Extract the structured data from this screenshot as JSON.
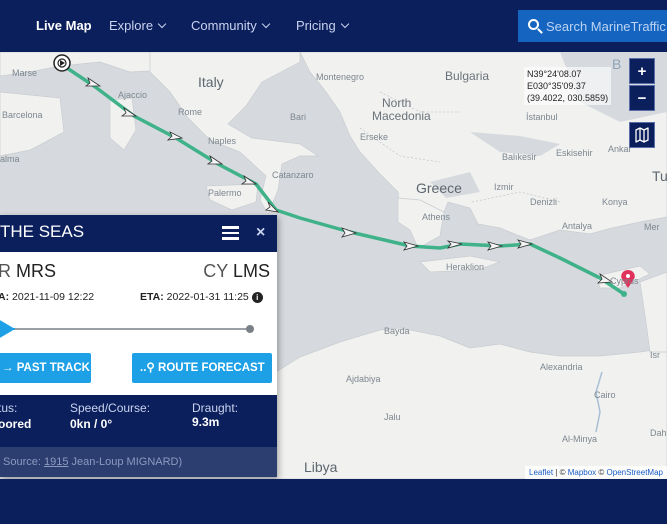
{
  "nav": {
    "items": [
      {
        "label": "Live Map",
        "active": true
      },
      {
        "label": "Explore"
      },
      {
        "label": "Community"
      },
      {
        "label": "Pricing"
      }
    ],
    "search_placeholder": "Search MarineTraffic"
  },
  "map": {
    "coords": {
      "lat": "N39°24'08.07",
      "lon": "E030°35'09.37",
      "decimal": "(39.4022, 030.5859)"
    },
    "controls": {
      "zoom_in": "+",
      "zoom_out": "−"
    },
    "labels": {
      "italy": "Italy",
      "bulgaria": "Bulgaria",
      "montenegro": "Montenegro",
      "north_macedonia_1": "North",
      "north_macedonia_2": "Macedonia",
      "greece": "Greece",
      "libya": "Libya",
      "marseille": "Marse",
      "barcelona": "Barcelona",
      "palma": "alma",
      "ajaccio": "Ajaccio",
      "rome": "Rome",
      "bari": "Bari",
      "naples": "Naples",
      "catanzaro": "Catanzaro",
      "palermo": "Palermo",
      "athens": "Athens",
      "heraklion": "Heraklion",
      "izmir": "Izmir",
      "denizli": "Denizli",
      "konya": "Konya",
      "antalya": "Antalya",
      "balikesir": "Balıkesir",
      "eskisehir": "Eskisehir",
      "ankara": "Ankar",
      "istanbul": "İstanbul",
      "erseke": "Erseke",
      "bayda": "Bayda",
      "ajdabiya": "Ajdabiya",
      "jalu": "Jalu",
      "alexandria": "Alexandria",
      "cairo": "Cairo",
      "al_minya": "Al-Minya",
      "cyprus": "Cyprus",
      "tu": "Tu",
      "mer": "Mer",
      "isr": "Isr",
      "dah": "Dah",
      "b": "B"
    },
    "attribution": {
      "leaflet": "Leaflet",
      "sep1": " | © ",
      "mapbox": "Mapbox",
      "sep2": " © ",
      "osm": "OpenStreetMap"
    },
    "colors": {
      "water": "#d6dade",
      "land": "#f1f1ef",
      "track": "#3fb28a"
    }
  },
  "vessel": {
    "name": "THE SEAS",
    "from_country": "R",
    "from_port": "MRS",
    "to_country": "CY",
    "to_port": "LMS",
    "atd_label": "A:",
    "atd_value": "2021-11-09 12:22",
    "eta_label": "ETA:",
    "eta_value": "2022-01-31 11:25",
    "progress": 0.03,
    "past_track_label": "PAST TRACK",
    "route_forecast_label": "ROUTE FORECAST",
    "status_label": "tus:",
    "status_value": "oored",
    "speed_label": "Speed/Course:",
    "speed_value": "0kn / 0°",
    "draught_label": "Draught:",
    "draught_value": "9.3m",
    "source_prefix": "Source: ",
    "source_link": "1915",
    "source_author": " Jean-Loup MIGNARD)"
  }
}
